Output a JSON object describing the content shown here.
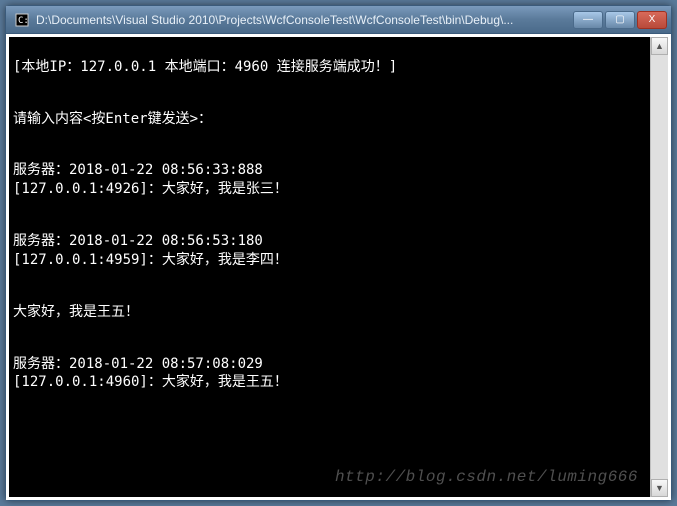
{
  "titlebar": {
    "title": "D:\\Documents\\Visual Studio 2010\\Projects\\WcfConsoleTest\\WcfConsoleTest\\bin\\Debug\\...",
    "minimize_label": "—",
    "maximize_label": "▢",
    "close_label": "X"
  },
  "console": {
    "header_line": "[本地IP：127.0.0.1 本地端口：4960 连接服务端成功！]",
    "prompt_line": "请输入内容<按Enter键发送>：",
    "messages": [
      {
        "server_line": "服务器：2018-01-22 08:56:33:888",
        "client_line": "[127.0.0.1:4926]：大家好，我是张三！"
      },
      {
        "server_line": "服务器：2018-01-22 08:56:53:180",
        "client_line": "[127.0.0.1:4959]：大家好，我是李四！"
      }
    ],
    "user_input": "大家好，我是王五！",
    "echo": {
      "server_line": "服务器：2018-01-22 08:57:08:029",
      "client_line": "[127.0.0.1:4960]：大家好，我是王五！"
    }
  },
  "watermark": "http://blog.csdn.net/luming666",
  "scrollbar": {
    "up": "▲",
    "down": "▼"
  }
}
